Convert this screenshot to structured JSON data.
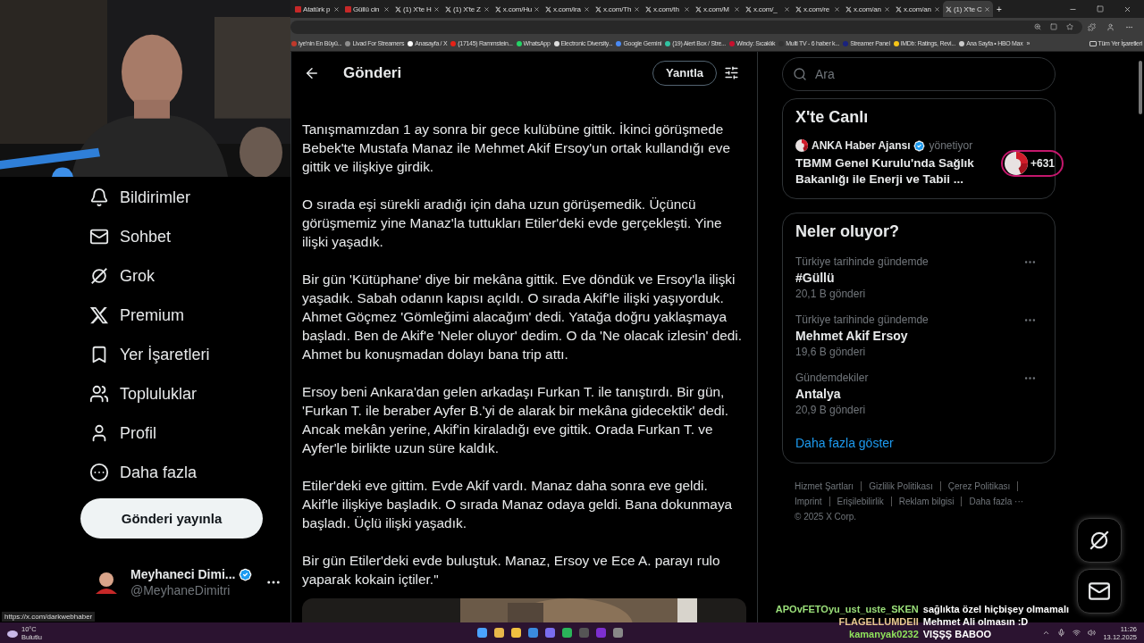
{
  "browser": {
    "tabs": [
      {
        "title": "Atatürk p",
        "kind": "site",
        "selected": false
      },
      {
        "title": "Güllü cin",
        "kind": "site",
        "selected": false
      },
      {
        "title": "(1) X'te H",
        "kind": "x",
        "selected": false
      },
      {
        "title": "(1) X'te Z",
        "kind": "x",
        "selected": false
      },
      {
        "title": "x.com/Hu",
        "kind": "x",
        "selected": false
      },
      {
        "title": "x.com/ira",
        "kind": "x",
        "selected": false
      },
      {
        "title": "x.com/Th",
        "kind": "x",
        "selected": false
      },
      {
        "title": "x.com/th",
        "kind": "x",
        "selected": false
      },
      {
        "title": "x.com/M",
        "kind": "x",
        "selected": false
      },
      {
        "title": "x.com/_",
        "kind": "x",
        "selected": false
      },
      {
        "title": "x.com/re",
        "kind": "x",
        "selected": false
      },
      {
        "title": "x.com/an",
        "kind": "x",
        "selected": false
      },
      {
        "title": "x.com/an",
        "kind": "x",
        "selected": false
      },
      {
        "title": "(1) X'te C",
        "kind": "x",
        "selected": true
      }
    ],
    "new_tab": "+",
    "bookmarks": [
      {
        "title": "iye'nin En Büyü...",
        "color": "#c0392b"
      },
      {
        "title": "Livad For Streamers",
        "color": "#8e8e8e"
      },
      {
        "title": "Anasayfa / X",
        "color": "#ffffff"
      },
      {
        "title": "(17145) Rammstein...",
        "color": "#e62117"
      },
      {
        "title": "WhatsApp",
        "color": "#25d366"
      },
      {
        "title": "Electronic Diversity...",
        "color": "#dddddd"
      },
      {
        "title": "Google Gemini",
        "color": "#4a8af4"
      },
      {
        "title": "(19) Alert Box / Stre...",
        "color": "#31c3a2"
      },
      {
        "title": "Windy: Sıcaklık",
        "color": "#c8102e"
      },
      {
        "title": "Multi TV - 6 haber k...",
        "color": "#333333"
      },
      {
        "title": "Streamer Panel",
        "color": "#1a237e"
      },
      {
        "title": "IMDb: Ratings, Revi...",
        "color": "#f5c518"
      },
      {
        "title": "Ana Sayfa • HBO Max",
        "color": "#cccccc"
      }
    ],
    "more_bookmarks": "»",
    "all_bookmarks": "Tüm Yer İşaretleri"
  },
  "sidebar": {
    "items": [
      {
        "label": "Bildirimler",
        "kind": "bell"
      },
      {
        "label": "Sohbet",
        "kind": "mail"
      },
      {
        "label": "Grok",
        "kind": "grok"
      },
      {
        "label": "Premium",
        "kind": "x"
      },
      {
        "label": "Yer İşaretleri",
        "kind": "bookmark"
      },
      {
        "label": "Topluluklar",
        "kind": "people"
      },
      {
        "label": "Profil",
        "kind": "person"
      },
      {
        "label": "Daha fazla",
        "kind": "more"
      }
    ],
    "post_button": "Gönderi yayınla",
    "account": {
      "name": "Meyhaneci Dimi...",
      "handle": "@MeyhaneDimitri",
      "verified": true
    }
  },
  "header": {
    "title": "Gönderi",
    "reply_button": "Yanıtla"
  },
  "post": {
    "paragraphs": [
      "Tanışmamızdan 1 ay sonra bir gece kulübüne gittik. İkinci görüşmede Bebek'te Mustafa Manaz ile Mehmet Akif Ersoy'un ortak kullandığı eve gittik ve ilişkiye girdik.",
      "O sırada eşi sürekli aradığı için daha uzun görüşemedik. Üçüncü görüşmemiz yine Manaz'la tuttukları Etiler'deki evde gerçekleşti. Yine ilişki yaşadık.",
      "Bir gün 'Kütüphane' diye bir mekâna gittik. Eve döndük ve Ersoy'la ilişki yaşadık. Sabah odanın kapısı açıldı. O sırada Akif'le ilişki yaşıyorduk. Ahmet Göçmez 'Gömleğimi alacağım' dedi. Yatağa doğru yaklaşmaya başladı. Ben de Akif'e 'Neler oluyor' dedim. O da 'Ne olacak izlesin' dedi. Ahmet bu konuşmadan dolayı bana trip attı.",
      "Ersoy beni Ankara'dan gelen arkadaşı Furkan T. ile tanıştırdı. Bir gün, 'Furkan T. ile beraber Ayfer B.'yi de alarak bir mekâna gidecektik' dedi. Ancak mekân yerine, Akif'in kiraladığı eve gittik. Orada Furkan T. ve Ayfer'le birlikte uzun süre kaldık.",
      "Etiler'deki eve gittim. Evde Akif vardı. Manaz daha sonra eve geldi. Akif'le ilişkiye başladık. O sırada Manaz odaya geldi. Bana dokunmaya başladı. Üçlü ilişki yaşadık.",
      "Bir gün Etiler'deki evde buluştuk. Manaz, Ersoy ve Ece A. parayı rulo yaparak kokain içtiler.\""
    ]
  },
  "search": {
    "placeholder": "Ara"
  },
  "live": {
    "title": "X'te Canlı",
    "host": "ANKA Haber Ajansı",
    "host_verified": true,
    "role": "yönetiyor",
    "headline": "TBMM Genel Kurulu'nda Sağlık Bakanlığı ile Enerji ve Tabii ...",
    "listeners": "+631"
  },
  "trends": {
    "title": "Neler oluyor?",
    "items": [
      {
        "context": "Türkiye tarihinde gündemde",
        "topic": "#Güllü",
        "count": "20,1 B gönderi"
      },
      {
        "context": "Türkiye tarihinde gündemde",
        "topic": "Mehmet Akif Ersoy",
        "count": "19,6 B gönderi"
      },
      {
        "context": "Gündemdekiler",
        "topic": "Antalya",
        "count": "20,9 B gönderi"
      }
    ],
    "show_more": "Daha fazla göster"
  },
  "footer": {
    "links": [
      "Hizmet Şartları",
      "Gizlilik Politikası",
      "Çerez Politikası",
      "Imprint",
      "Erişilebilirlik",
      "Reklam bilgisi",
      "Daha fazla ···"
    ],
    "copyright": "© 2025 X Corp."
  },
  "status_url": "https://x.com/darkwebhaber",
  "chat": [
    {
      "user": "APOvFETOyu_ust_uste_SKEN",
      "message": "sağlıkta özel hiçbişey olmamalı",
      "color": "#9be07a"
    },
    {
      "user": "FLAGELLUMDEII",
      "message": "Mehmet Ali olmasın :D",
      "color": "#e8c890"
    },
    {
      "user": "kamanyak0232",
      "message": "VIŞŞŞ BABOO",
      "color": "#8fe35c"
    }
  ],
  "taskbar": {
    "temperature": "10°C",
    "weather": "Bulutlu",
    "time": "11:26",
    "date": "13.12.2025"
  }
}
